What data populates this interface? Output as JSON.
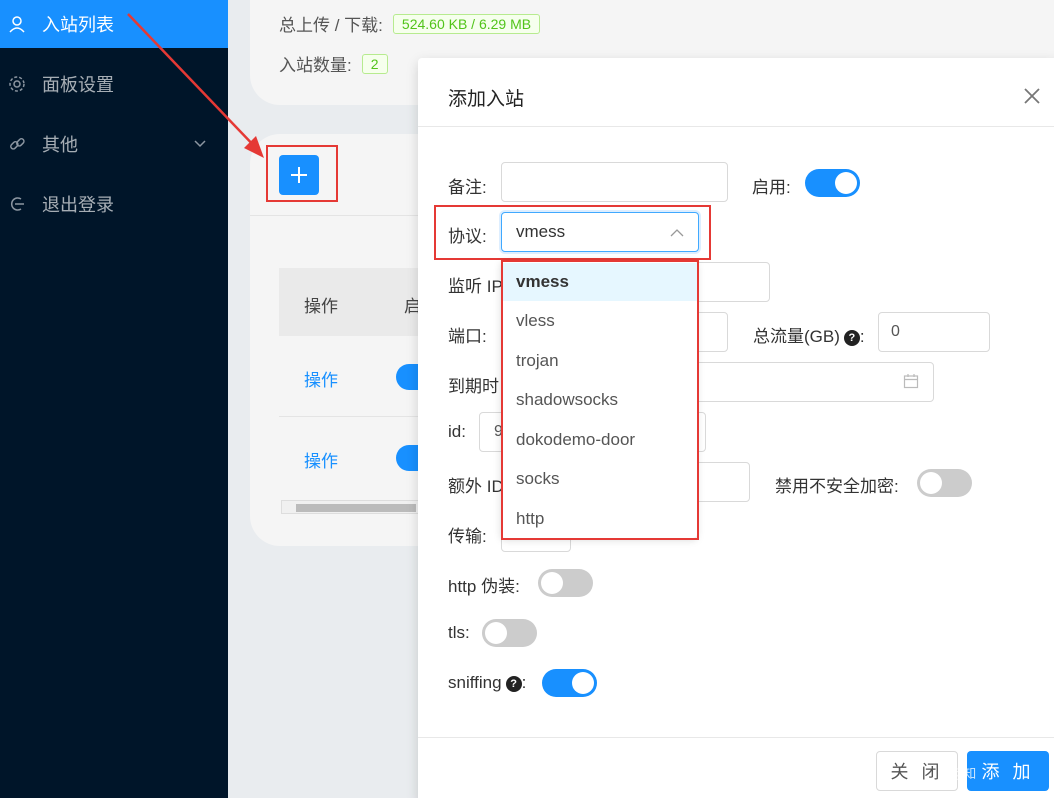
{
  "sidebar": {
    "items": [
      {
        "label": "入站列表",
        "icon": "user-icon"
      },
      {
        "label": "面板设置",
        "icon": "gear-icon"
      },
      {
        "label": "其他",
        "icon": "link-icon"
      },
      {
        "label": "退出登录",
        "icon": "logout-icon"
      }
    ]
  },
  "stats": {
    "traffic_label": "总上传 / 下载:",
    "traffic_value": "524.60 KB / 6.29 MB",
    "count_label": "入站数量:",
    "count_value": "2"
  },
  "table": {
    "col_op": "操作",
    "col_enable": "启",
    "row_op": "操作"
  },
  "modal": {
    "title": "添加入站",
    "form": {
      "remark_label": "备注:",
      "remark_value": "",
      "enable_label": "启用:",
      "protocol_label": "协议:",
      "protocol_value": "vmess",
      "listen_ip_label": "监听 IP",
      "port_label": "端口:",
      "total_traffic_label": "总流量(GB)",
      "total_traffic_colon": ":",
      "total_traffic_value": "0",
      "expiry_label": "到期时",
      "id_label": "id:",
      "id_value": "9",
      "alter_id_label": "额外 ID",
      "disable_insecure_label": "禁用不安全加密:",
      "transport_label": "传输:",
      "http_disguise_label": "http 伪装:",
      "tls_label": "tls:",
      "sniffing_label": "sniffing",
      "sniffing_colon": ":"
    },
    "protocol_options": [
      "vmess",
      "vless",
      "trojan",
      "shadowsocks",
      "dokodemo-door",
      "socks",
      "http"
    ],
    "buttons": {
      "close": "关 闭",
      "add": "添 加"
    }
  },
  "watermark": "@知"
}
